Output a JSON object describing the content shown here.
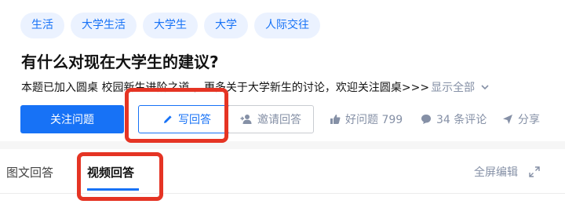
{
  "tags": [
    "生活",
    "大学生活",
    "大学生",
    "大学",
    "人际交往"
  ],
  "question": {
    "title": "有什么对现在大学生的建议?",
    "description": "本题已加入圆桌 校园新生进阶之道 ，更多关于大学新生的讨论，欢迎关注圆桌>>>",
    "show_all": "显示全部"
  },
  "actions": {
    "follow_label": "关注问题",
    "write_label": "写回答",
    "invite_label": "邀请回答",
    "good_question_label": "好问题 799",
    "comments_label": "34 条评论",
    "share_label": "分享"
  },
  "tabs": {
    "text_answer": "图文回答",
    "video_answer": "视频回答",
    "fullscreen_edit": "全屏编辑"
  },
  "colors": {
    "accent": "#1772f6",
    "highlight": "#e53424",
    "muted": "#8590a6"
  }
}
